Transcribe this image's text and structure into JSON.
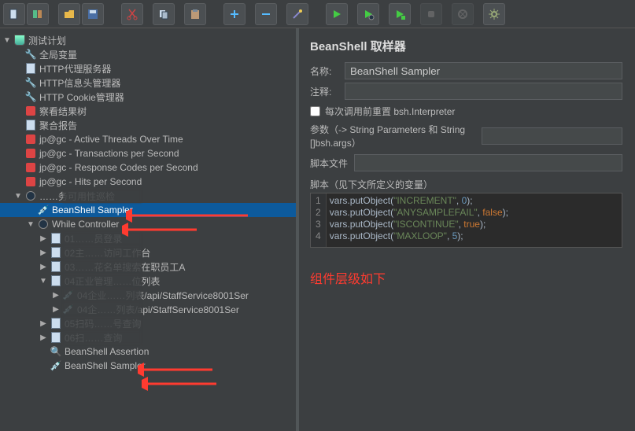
{
  "toolbar": {
    "buttons": [
      "new",
      "templates",
      "open",
      "save",
      "cut",
      "copy",
      "paste",
      "add",
      "remove",
      "wand",
      "run",
      "run-next",
      "run-green",
      "stop",
      "stop2",
      "gear"
    ]
  },
  "tree": {
    "root": "测试计划",
    "items": [
      {
        "l": "全局变量",
        "i": 1,
        "ic": "wrench"
      },
      {
        "l": "HTTP代理服务器",
        "i": 1,
        "ic": "doc"
      },
      {
        "l": "HTTP信息头管理器",
        "i": 1,
        "ic": "wrench"
      },
      {
        "l": "HTTP Cookie管理器",
        "i": 1,
        "ic": "wrench"
      },
      {
        "l": "察看结果树",
        "i": 1,
        "ic": "new"
      },
      {
        "l": "聚合报告",
        "i": 1,
        "ic": "doc"
      },
      {
        "l": "jp@gc - Active Threads Over Time",
        "i": 1,
        "ic": "new"
      },
      {
        "l": "jp@gc - Transactions per Second",
        "i": 1,
        "ic": "new"
      },
      {
        "l": "jp@gc - Response Codes per Second",
        "i": 1,
        "ic": "new"
      },
      {
        "l": "jp@gc - Hits per Second",
        "i": 1,
        "ic": "new"
      },
      {
        "l": "……务可用性巡检",
        "i": 1,
        "ic": "clock",
        "arrow": "▼",
        "blur": true
      },
      {
        "l": "BeanShell Sampler",
        "i": 2,
        "ic": "dropper",
        "sel": true
      },
      {
        "l": "While Controller",
        "i": 2,
        "ic": "clock",
        "arrow": "▼"
      },
      {
        "l": "01……员登录",
        "i": 3,
        "ic": "doc",
        "arrow": "▶",
        "blur": true
      },
      {
        "l": "02主……访问工作台",
        "i": 3,
        "ic": "doc",
        "arrow": "▶",
        "blur": true
      },
      {
        "l": "03……花名单搜索在职员工A",
        "i": 3,
        "ic": "doc",
        "arrow": "▶",
        "blur": true
      },
      {
        "l": "04正业管理……位列表",
        "i": 3,
        "ic": "doc",
        "arrow": "▼",
        "blur": true
      },
      {
        "l": "04企业……列表/api/StaffService8001Ser",
        "i": 4,
        "ic": "dropper",
        "arrow": "▶",
        "blur": true
      },
      {
        "l": "04企……列表/api/StaffService8001Ser",
        "i": 4,
        "ic": "dropper",
        "arrow": "▶",
        "blur": true
      },
      {
        "l": "05扫码……号查询",
        "i": 3,
        "ic": "doc",
        "arrow": "▶",
        "blur": true
      },
      {
        "l": "06扫……查询",
        "i": 3,
        "ic": "doc",
        "arrow": "▶",
        "blur": true
      },
      {
        "l": "BeanShell Assertion",
        "i": 3,
        "ic": "mag"
      },
      {
        "l": "BeanShell Sampler",
        "i": 3,
        "ic": "dropper"
      }
    ]
  },
  "panel": {
    "title": "BeanShell 取样器",
    "name_label": "名称:",
    "name_value": "BeanShell Sampler",
    "comment_label": "注释:",
    "comment_value": "",
    "reset_label": "每次调用前重置 bsh.Interpreter",
    "params_label": "参数（-> String Parameters 和 String []bsh.args）",
    "script_file_label": "脚本文件",
    "script_label": "脚本（见下文所定义的变量）"
  },
  "code_lines": [
    {
      "fn": "vars.putObject",
      "str": "\"INCREMENT\"",
      "val": "0",
      "kw": false
    },
    {
      "fn": "vars.putObject",
      "str": "\"ANYSAMPLEFAIL\"",
      "val": "false",
      "kw": true
    },
    {
      "fn": "vars.putObject",
      "str": "\"ISCONTINUE\"",
      "val": "true",
      "kw": true
    },
    {
      "fn": "vars.putObject",
      "str": "\"MAXLOOP\"",
      "val": "5",
      "kw": false
    }
  ],
  "annotation": "组件层级如下"
}
